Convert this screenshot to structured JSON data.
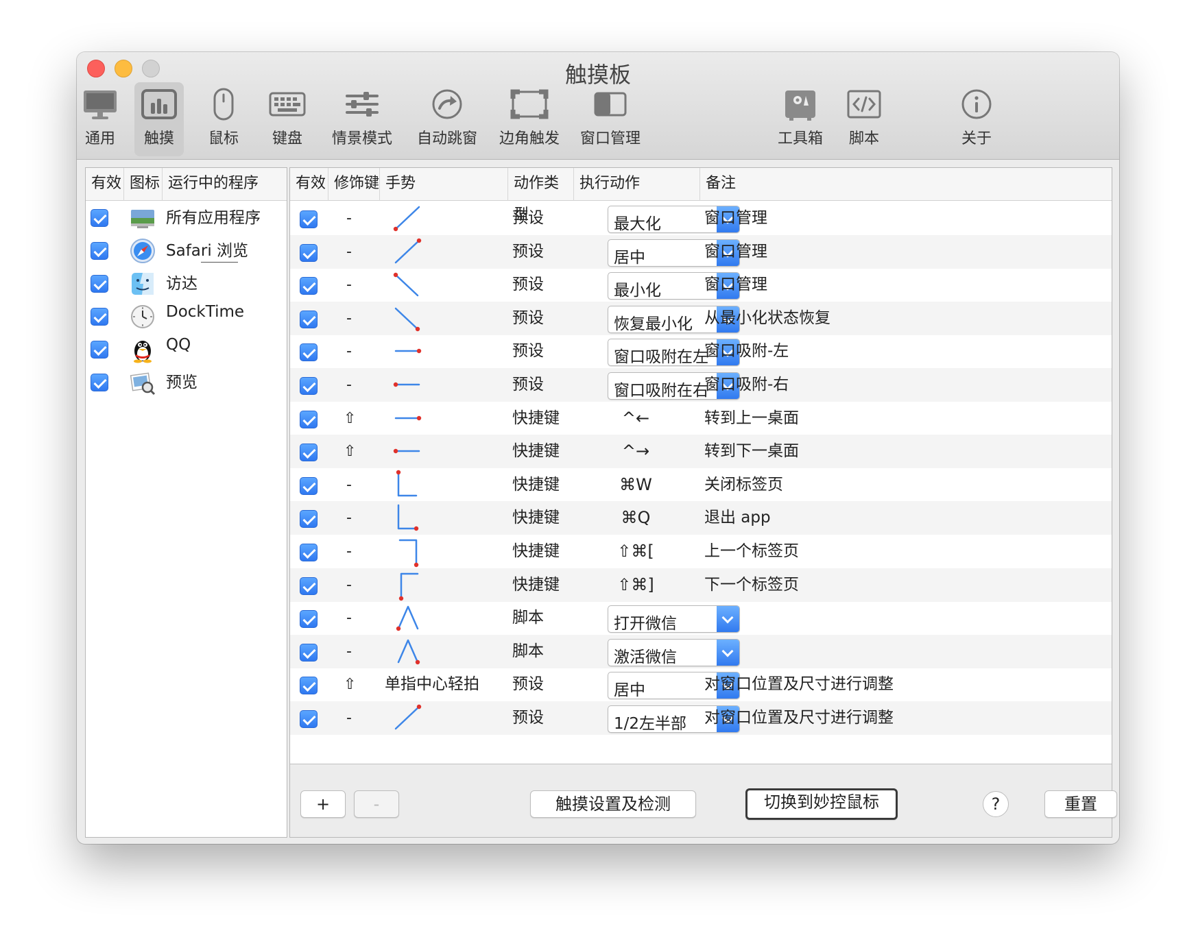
{
  "window": {
    "title": "触摸板",
    "traffic_lights": {
      "close": "#fc605c",
      "minimize": "#fdbc40",
      "zoom": "#c9c9c9"
    }
  },
  "toolbar": {
    "items": [
      {
        "label": "通用",
        "icon": "monitor-icon"
      },
      {
        "label": "触摸",
        "icon": "trackpad-icon",
        "selected": true
      },
      {
        "label": "鼠标",
        "icon": "mouse-icon"
      },
      {
        "label": "键盘",
        "icon": "keyboard-icon"
      },
      {
        "label": "情景模式",
        "icon": "sliders-icon"
      },
      {
        "label": "自动跳窗",
        "icon": "auto-jump-icon"
      },
      {
        "label": "边角触发",
        "icon": "corner-trigger-icon"
      },
      {
        "label": "窗口管理",
        "icon": "window-manage-icon"
      },
      {
        "label": "工具箱",
        "icon": "toolbox-icon"
      },
      {
        "label": "脚本",
        "icon": "script-icon"
      },
      {
        "label": "关于",
        "icon": "info-icon"
      }
    ]
  },
  "apps_table": {
    "headers": [
      "有效",
      "图标",
      "运行中的程序"
    ],
    "rows": [
      {
        "name": "所有应用程序",
        "icon": "all-apps-icon",
        "enabled": true
      },
      {
        "name": "Safari 浏览",
        "icon": "safari-icon",
        "enabled": true
      },
      {
        "name": "访达",
        "icon": "finder-icon",
        "enabled": true
      },
      {
        "name": "DockTime",
        "icon": "clock-icon",
        "enabled": true
      },
      {
        "name": "QQ",
        "icon": "qq-penguin-icon",
        "enabled": true
      },
      {
        "name": "预览",
        "icon": "preview-icon",
        "enabled": true
      }
    ]
  },
  "gestures_table": {
    "headers": [
      "有效",
      "修饰键",
      "手势",
      "动作类型",
      "执行动作",
      "备注"
    ],
    "rows": [
      {
        "enabled": true,
        "modifier": "-",
        "gesture": "diag-up-right-start",
        "gesture_text": "",
        "type": "预设",
        "action": "最大化",
        "action_is_select": true,
        "note": "窗口管理"
      },
      {
        "enabled": true,
        "modifier": "-",
        "gesture": "diag-up-right-end",
        "gesture_text": "",
        "type": "预设",
        "action": "居中",
        "action_is_select": true,
        "note": "窗口管理"
      },
      {
        "enabled": true,
        "modifier": "-",
        "gesture": "diag-down-right-start",
        "gesture_text": "",
        "type": "预设",
        "action": "最小化",
        "action_is_select": true,
        "note": "窗口管理"
      },
      {
        "enabled": true,
        "modifier": "-",
        "gesture": "diag-down-right-end",
        "gesture_text": "",
        "type": "预设",
        "action": "恢复最小化",
        "action_is_select": true,
        "note": "从最小化状态恢复"
      },
      {
        "enabled": true,
        "modifier": "-",
        "gesture": "horiz-right",
        "gesture_text": "",
        "type": "预设",
        "action": "窗口吸附在左",
        "action_is_select": true,
        "note": "窗口吸附-左"
      },
      {
        "enabled": true,
        "modifier": "-",
        "gesture": "horiz-left",
        "gesture_text": "",
        "type": "预设",
        "action": "窗口吸附在右",
        "action_is_select": true,
        "note": "窗口吸附-右"
      },
      {
        "enabled": true,
        "modifier": "⇧",
        "gesture": "horiz-right",
        "gesture_text": "",
        "type": "快捷键",
        "action": "^←",
        "action_is_select": false,
        "note": "转到上一桌面"
      },
      {
        "enabled": true,
        "modifier": "⇧",
        "gesture": "horiz-left",
        "gesture_text": "",
        "type": "快捷键",
        "action": "^→",
        "action_is_select": false,
        "note": "转到下一桌面"
      },
      {
        "enabled": true,
        "modifier": "-",
        "gesture": "L-start",
        "gesture_text": "",
        "type": "快捷键",
        "action": "⌘W",
        "action_is_select": false,
        "note": "关闭标签页"
      },
      {
        "enabled": true,
        "modifier": "-",
        "gesture": "L-end",
        "gesture_text": "",
        "type": "快捷键",
        "action": "⌘Q",
        "action_is_select": false,
        "note": "退出 app"
      },
      {
        "enabled": true,
        "modifier": "-",
        "gesture": "hook-down-end",
        "gesture_text": "",
        "type": "快捷键",
        "action": "⇧⌘[",
        "action_is_select": false,
        "note": "上一个标签页"
      },
      {
        "enabled": true,
        "modifier": "-",
        "gesture": "hook-up-start",
        "gesture_text": "",
        "type": "快捷键",
        "action": "⇧⌘]",
        "action_is_select": false,
        "note": "下一个标签页"
      },
      {
        "enabled": true,
        "modifier": "-",
        "gesture": "peak-start",
        "gesture_text": "",
        "type": "脚本",
        "action": "打开微信",
        "action_is_select": true,
        "note": ""
      },
      {
        "enabled": true,
        "modifier": "-",
        "gesture": "peak-end",
        "gesture_text": "",
        "type": "脚本",
        "action": "激活微信",
        "action_is_select": true,
        "note": ""
      },
      {
        "enabled": true,
        "modifier": "⇧",
        "gesture": "none",
        "gesture_text": "单指中心轻拍",
        "type": "预设",
        "action": "居中",
        "action_is_select": true,
        "note": "对窗口位置及尺寸进行调整"
      },
      {
        "enabled": true,
        "modifier": "-",
        "gesture": "diag-up-right-end",
        "gesture_text": "",
        "type": "预设",
        "action": "1/2左半部",
        "action_is_select": true,
        "note": "对窗口位置及尺寸进行调整"
      }
    ]
  },
  "colors": {
    "accent": "#3478f6",
    "gesture_line": "#3d86e8",
    "gesture_dot": "#e0312b"
  },
  "buttons": {
    "add": "+",
    "remove": "-",
    "settings": "触摸设置及检测",
    "switch": "切换到妙控鼠标",
    "help": "?",
    "reset": "重置"
  }
}
